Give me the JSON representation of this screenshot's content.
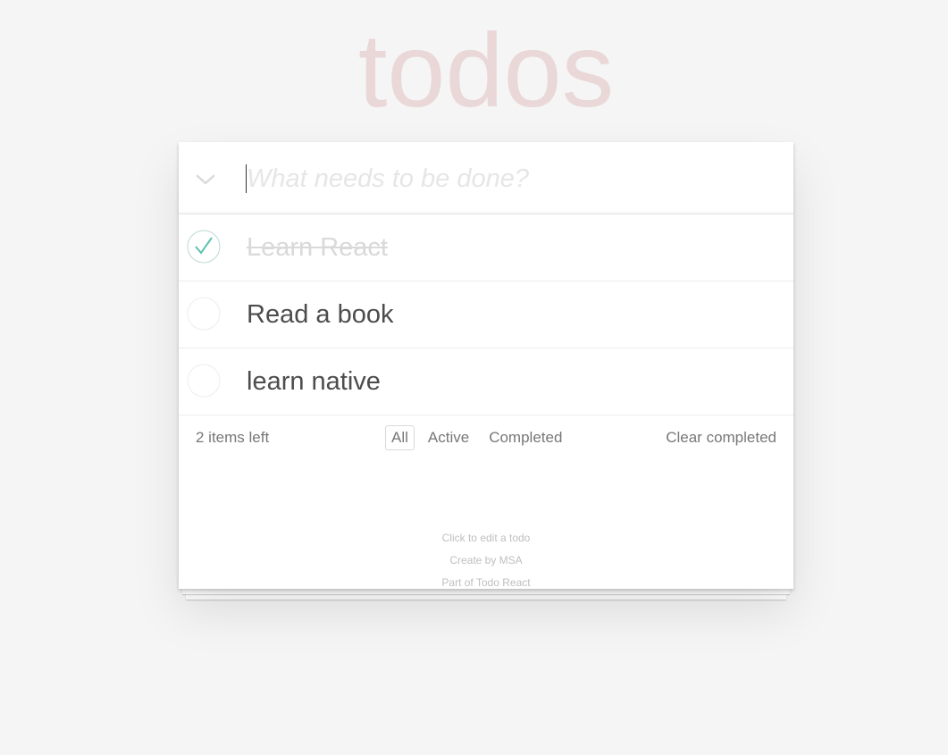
{
  "app": {
    "title": "todos"
  },
  "new_todo": {
    "placeholder": "What needs to be done?",
    "value": ""
  },
  "todos": [
    {
      "title": "Learn React",
      "completed": true
    },
    {
      "title": "Read a book",
      "completed": false
    },
    {
      "title": "learn native",
      "completed": false
    }
  ],
  "footer": {
    "count_label": "2 items left",
    "filters": [
      "All",
      "Active",
      "Completed"
    ],
    "selected_filter": "All",
    "clear_label": "Clear completed"
  },
  "info": {
    "line1": "Click to edit a todo",
    "line2": "Create by MSA",
    "line3": "Part of Todo React"
  },
  "colors": {
    "title": "#ead7d7",
    "check": "#5dc2af",
    "circle": "#ededed",
    "completed_text": "#d9d9d9"
  }
}
